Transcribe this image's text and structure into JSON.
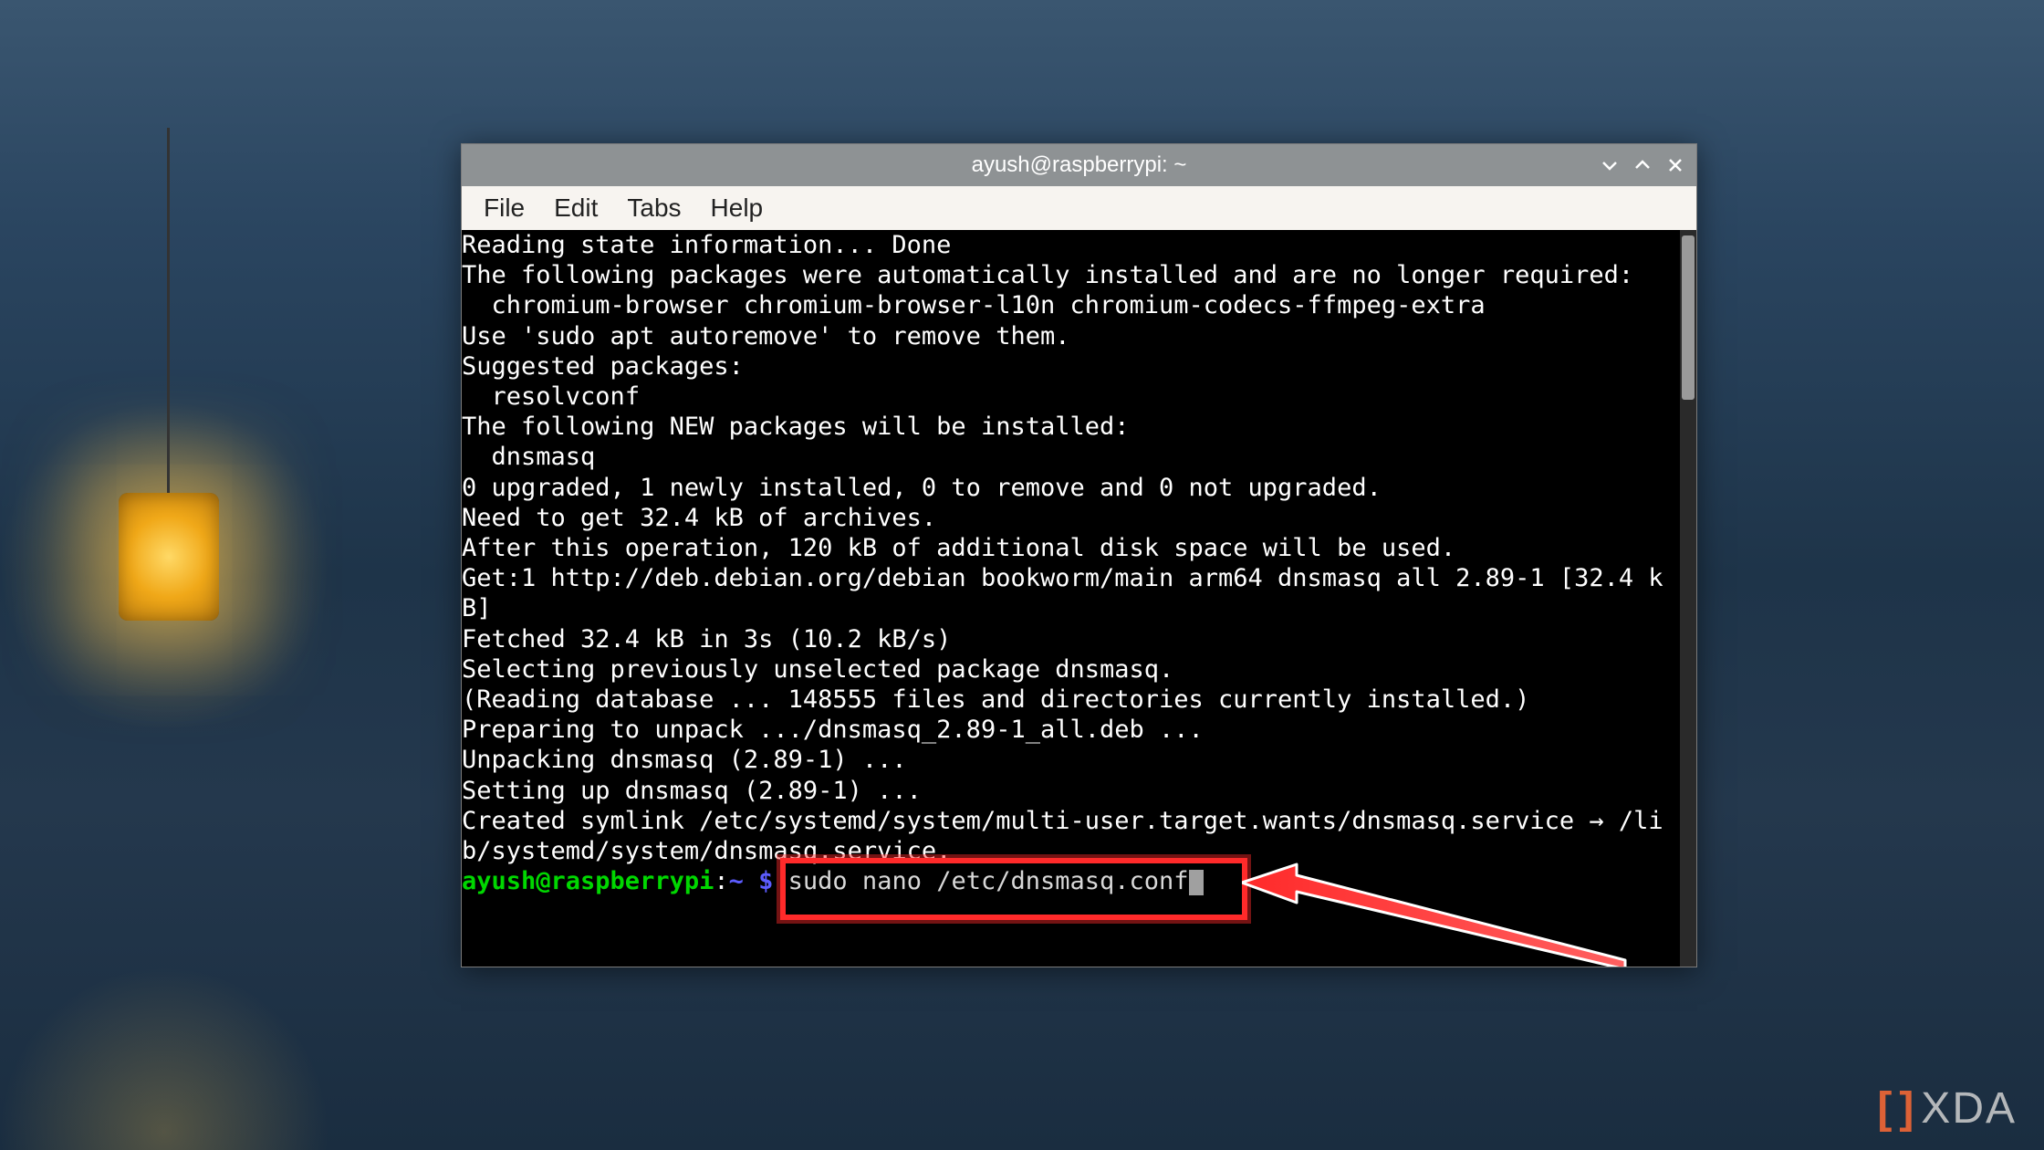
{
  "window": {
    "title": "ayush@raspberrypi: ~",
    "menu": {
      "file": "File",
      "edit": "Edit",
      "tabs": "Tabs",
      "help": "Help"
    }
  },
  "terminal": {
    "output_lines": [
      "Reading state information... Done",
      "The following packages were automatically installed and are no longer required:",
      "  chromium-browser chromium-browser-l10n chromium-codecs-ffmpeg-extra",
      "Use 'sudo apt autoremove' to remove them.",
      "Suggested packages:",
      "  resolvconf",
      "The following NEW packages will be installed:",
      "  dnsmasq",
      "0 upgraded, 1 newly installed, 0 to remove and 0 not upgraded.",
      "Need to get 32.4 kB of archives.",
      "After this operation, 120 kB of additional disk space will be used.",
      "Get:1 http://deb.debian.org/debian bookworm/main arm64 dnsmasq all 2.89-1 [32.4 kB]",
      "Fetched 32.4 kB in 3s (10.2 kB/s)",
      "Selecting previously unselected package dnsmasq.",
      "(Reading database ... 148555 files and directories currently installed.)",
      "Preparing to unpack .../dnsmasq_2.89-1_all.deb ...",
      "Unpacking dnsmasq (2.89-1) ...",
      "Setting up dnsmasq (2.89-1) ...",
      "Created symlink /etc/systemd/system/multi-user.target.wants/dnsmasq.service → /lib/systemd/system/dnsmasq.service."
    ],
    "prompt": {
      "user_host": "ayush@raspberrypi",
      "sep": ":",
      "path": "~",
      "dollar": " $ "
    },
    "command": "sudo nano /etc/dnsmasq.conf"
  },
  "watermark": {
    "bracket_l": "[",
    "bracket_r": "]",
    "text": "XDA"
  }
}
